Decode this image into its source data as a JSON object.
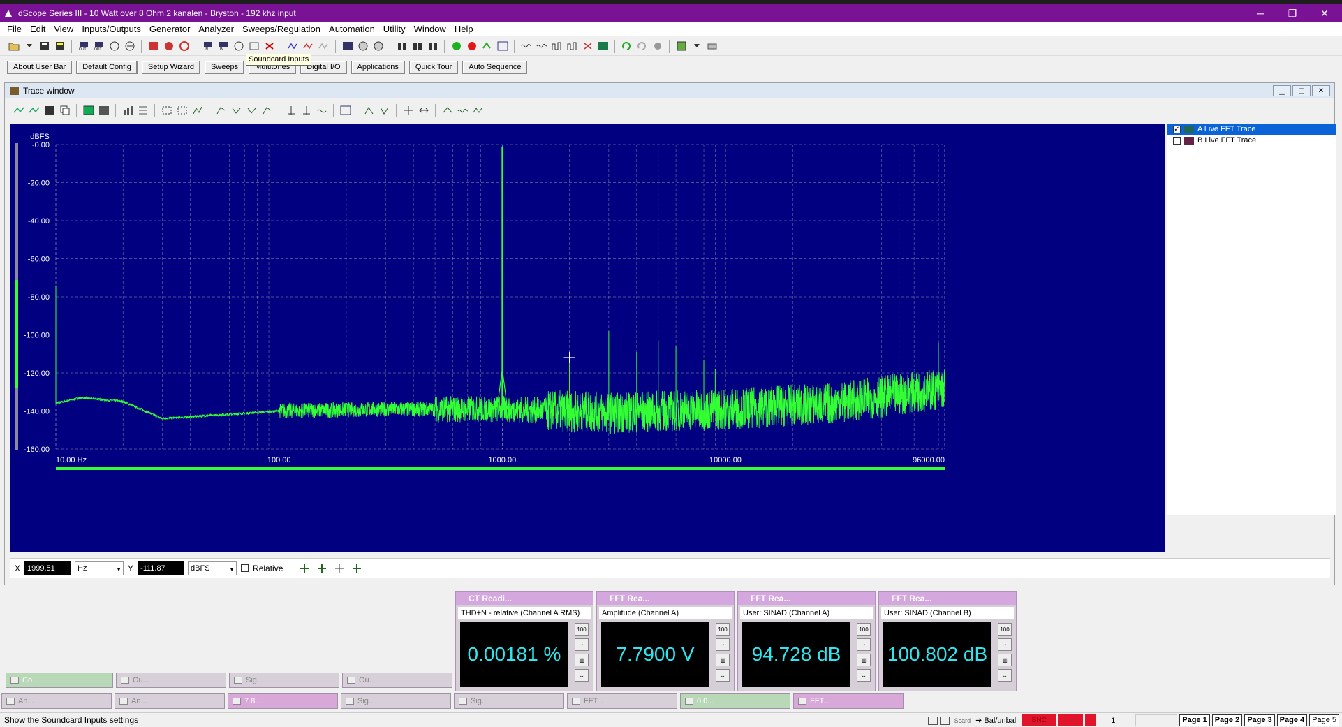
{
  "window": {
    "title": "dScope Series III - 10 Watt over 8 Ohm 2 kanalen - Bryston - 192 khz input",
    "minimize": "─",
    "restore": "❐",
    "close": "✕"
  },
  "menu": [
    "File",
    "Edit",
    "View",
    "Inputs/Outputs",
    "Generator",
    "Analyzer",
    "Sweeps/Regulation",
    "Automation",
    "Utility",
    "Window",
    "Help"
  ],
  "tooltip": "Soundcard Inputs",
  "user_bar": [
    "About User Bar",
    "Default Config",
    "Setup Wizard",
    "Sweeps",
    "Multitones",
    "Digital I/O",
    "Applications",
    "Quick Tour",
    "Auto Sequence"
  ],
  "trace_window": {
    "title": "Trace window",
    "legend": [
      {
        "label": "A  Live FFT Trace",
        "checked": true
      },
      {
        "label": "B  Live FFT Trace",
        "checked": false
      }
    ],
    "cursor": {
      "x_label": "X",
      "x_value": "1999.51",
      "x_unit": "Hz",
      "y_label": "Y",
      "y_value": "-111.87",
      "y_unit": "dBFS",
      "relative_label": "Relative"
    }
  },
  "chart_data": {
    "type": "line",
    "title": "",
    "ylabel": "dBFS",
    "xlabel": "",
    "x_scale": "log",
    "xlim": [
      10,
      96000
    ],
    "ylim": [
      -160,
      0
    ],
    "y_ticks": [
      "-0.00",
      "-20.00",
      "-40.00",
      "-60.00",
      "-80.00",
      "-100.00",
      "-120.00",
      "-140.00",
      "-160.00"
    ],
    "x_ticks": [
      "10.00 Hz",
      "100.00",
      "1000.00",
      "10000.00",
      "96000.00"
    ],
    "series": [
      {
        "color": "#33ff33",
        "noise_floor": [
          [
            10,
            -136
          ],
          [
            13,
            -133
          ],
          [
            20,
            -135
          ],
          [
            30,
            -144
          ],
          [
            100,
            -140
          ],
          [
            300,
            -139
          ],
          [
            1000,
            -139
          ],
          [
            3000,
            -141
          ],
          [
            10000,
            -139
          ],
          [
            30000,
            -136
          ],
          [
            96000,
            -128
          ]
        ],
        "peaks": [
          [
            1000,
            -1
          ],
          [
            10,
            -74
          ],
          [
            2000,
            -109
          ],
          [
            3000,
            -98
          ],
          [
            4000,
            -109
          ],
          [
            5000,
            -103
          ],
          [
            6000,
            -106
          ],
          [
            7000,
            -113
          ],
          [
            8000,
            -113
          ],
          [
            9000,
            -118
          ],
          [
            90000,
            -104
          ]
        ]
      }
    ],
    "grid": true,
    "colors": {
      "background": "#000080",
      "trace": "#33ff33",
      "grid": "#c0c0c0"
    }
  },
  "readers": [
    {
      "title": "CT Readi...",
      "label": "THD+N - relative (Channel A RMS)",
      "value": "0.00181 %"
    },
    {
      "title": "FFT Rea...",
      "label": "Amplitude (Channel A)",
      "value": "7.7900 V"
    },
    {
      "title": "FFT Rea...",
      "label": "User: SINAD (Channel A)",
      "value": "94.728 dB"
    },
    {
      "title": "FFT Rea...",
      "label": "User: SINAD (Channel B)",
      "value": "100.802 dB"
    }
  ],
  "taskbar_row1": [
    "Co...",
    "Ou...",
    "Sig...",
    "Ou..."
  ],
  "taskbar_row2": [
    "An...",
    "An...",
    "7.8...",
    "Sig...",
    "Sig...",
    "FFT...",
    "0.0...",
    "FFT..."
  ],
  "status": {
    "text": "Show the Soundcard Inputs settings",
    "scard": "Scard",
    "balunbal": "Bal/unbal",
    "bnc": "BNC",
    "counter": "1",
    "pages": [
      "Page 1",
      "Page 2",
      "Page 3",
      "Page 4",
      "Page 5"
    ]
  }
}
